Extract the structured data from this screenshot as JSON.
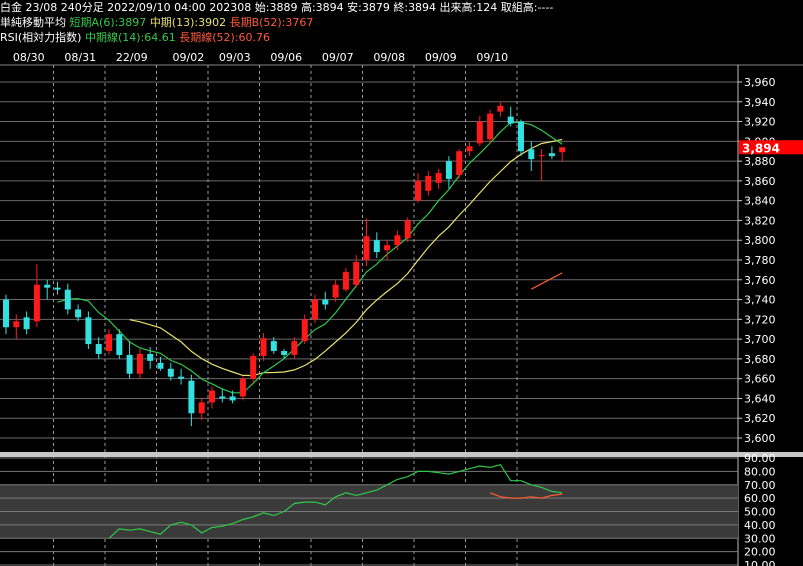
{
  "header": {
    "line1": "白金 23/08 240分足 2022/09/10 04:00 202308 始:3889 高:3894 安:3879 終:3894 出来高:124 取組高:----",
    "ma_label": "単純移動平均",
    "ma_short": "短期A(6):3897",
    "ma_mid": "中期(13):3902",
    "ma_long": "長期B(52):3767",
    "rsi_label": "RSI(相対力指数)",
    "rsi_mid": "中期線(14):64.61",
    "rsi_long": "長期線(52):60.76"
  },
  "colors": {
    "up": "#ff1a1a",
    "down": "#33e0e0",
    "ma_short": "#2ec84a",
    "ma_mid": "#e8e070",
    "ma_long": "#ff5a30",
    "rsi_mid": "#2ec84a",
    "rsi_long": "#ff5a30",
    "price_tag": "#ff0000"
  },
  "chart_data": {
    "type": "candlestick",
    "date_labels": [
      "08/30",
      "08/31",
      "22/09",
      "09/02",
      "09/03",
      "09/06",
      "09/07",
      "09/08",
      "09/09",
      "09/10"
    ],
    "date_bar_index": [
      2.5,
      7.5,
      12.5,
      18,
      22.5,
      27.5,
      32.5,
      37.5,
      42.5,
      47.5
    ],
    "price_axis": {
      "min": 3600,
      "max": 3960,
      "step": 20
    },
    "price_ticks": [
      "3,960",
      "3,940",
      "3,920",
      "3,900",
      "3,880",
      "3,860",
      "3,840",
      "3,820",
      "3,800",
      "3,780",
      "3,760",
      "3,740",
      "3,720",
      "3,700",
      "3,680",
      "3,660",
      "3,640",
      "3,620",
      "3,600"
    ],
    "last_price_label": "3,894",
    "last_price": 3894,
    "candles": [
      [
        3740,
        3745,
        3705,
        3712
      ],
      [
        3712,
        3725,
        3700,
        3718
      ],
      [
        3722,
        3728,
        3705,
        3710
      ],
      [
        3718,
        3776,
        3712,
        3755
      ],
      [
        3755,
        3760,
        3740,
        3752
      ],
      [
        3752,
        3758,
        3745,
        3750
      ],
      [
        3750,
        3756,
        3725,
        3730
      ],
      [
        3730,
        3735,
        3718,
        3722
      ],
      [
        3722,
        3728,
        3690,
        3695
      ],
      [
        3695,
        3702,
        3680,
        3685
      ],
      [
        3688,
        3710,
        3684,
        3705
      ],
      [
        3705,
        3710,
        3680,
        3684
      ],
      [
        3684,
        3698,
        3660,
        3665
      ],
      [
        3665,
        3690,
        3660,
        3685
      ],
      [
        3685,
        3692,
        3670,
        3678
      ],
      [
        3676,
        3682,
        3668,
        3670
      ],
      [
        3670,
        3676,
        3658,
        3662
      ],
      [
        3662,
        3670,
        3654,
        3660
      ],
      [
        3658,
        3664,
        3612,
        3625
      ],
      [
        3625,
        3640,
        3618,
        3636
      ],
      [
        3636,
        3652,
        3630,
        3648
      ],
      [
        3642,
        3650,
        3636,
        3640
      ],
      [
        3642,
        3648,
        3635,
        3638
      ],
      [
        3642,
        3662,
        3638,
        3660
      ],
      [
        3660,
        3686,
        3656,
        3683
      ],
      [
        3683,
        3706,
        3678,
        3701
      ],
      [
        3698,
        3702,
        3685,
        3688
      ],
      [
        3688,
        3690,
        3680,
        3684
      ],
      [
        3684,
        3702,
        3680,
        3698
      ],
      [
        3698,
        3725,
        3695,
        3720
      ],
      [
        3720,
        3745,
        3716,
        3740
      ],
      [
        3740,
        3748,
        3730,
        3735
      ],
      [
        3742,
        3760,
        3738,
        3755
      ],
      [
        3750,
        3772,
        3748,
        3768
      ],
      [
        3755,
        3785,
        3752,
        3778
      ],
      [
        3780,
        3822,
        3774,
        3804
      ],
      [
        3800,
        3808,
        3782,
        3788
      ],
      [
        3790,
        3800,
        3780,
        3795
      ],
      [
        3795,
        3810,
        3790,
        3805
      ],
      [
        3802,
        3823,
        3798,
        3820
      ],
      [
        3840,
        3868,
        3838,
        3860
      ],
      [
        3850,
        3870,
        3845,
        3865
      ],
      [
        3858,
        3872,
        3852,
        3868
      ],
      [
        3880,
        3885,
        3852,
        3862
      ],
      [
        3866,
        3892,
        3862,
        3890
      ],
      [
        3890,
        3900,
        3885,
        3895
      ],
      [
        3898,
        3926,
        3895,
        3920
      ],
      [
        3902,
        3932,
        3898,
        3928
      ],
      [
        3930,
        3940,
        3925,
        3936
      ],
      [
        3925,
        3935,
        3915,
        3918
      ],
      [
        3920,
        3922,
        3885,
        3890
      ],
      [
        3892,
        3900,
        3870,
        3882
      ],
      [
        3885,
        3892,
        3860,
        3886
      ],
      [
        3888,
        3895,
        3882,
        3885
      ],
      [
        3889,
        3894,
        3879,
        3894
      ]
    ],
    "ma_short_start": 5,
    "ma_mid_start": 12,
    "ma_long_start": 51,
    "ma_short_last": 3897,
    "ma_mid_last": 3902,
    "ma_long_last": 3767,
    "rsi_axis": {
      "min": 10,
      "max": 90,
      "step": 10
    },
    "rsi_ticks": [
      "90.00",
      "80.00",
      "70.00",
      "60.00",
      "50.00",
      "40.00",
      "30.00",
      "20.00",
      "10.00"
    ],
    "rsi_mid_values": [
      30,
      37,
      36,
      37,
      35,
      33,
      40,
      42,
      40,
      34,
      38,
      39,
      41,
      44,
      46,
      49,
      47,
      50,
      56,
      57,
      57,
      55,
      61,
      64,
      62,
      64,
      66,
      70,
      74,
      76,
      80,
      80,
      79,
      78,
      80,
      82,
      84,
      83,
      85,
      73,
      73,
      70,
      68,
      65,
      64
    ],
    "rsi_mid_start": 14,
    "rsi_long_values": [
      64,
      61,
      60,
      60,
      61,
      60,
      62,
      63
    ],
    "rsi_long_start": 51,
    "rsi_mid_last": 64.61,
    "rsi_long_last": 60.76
  }
}
